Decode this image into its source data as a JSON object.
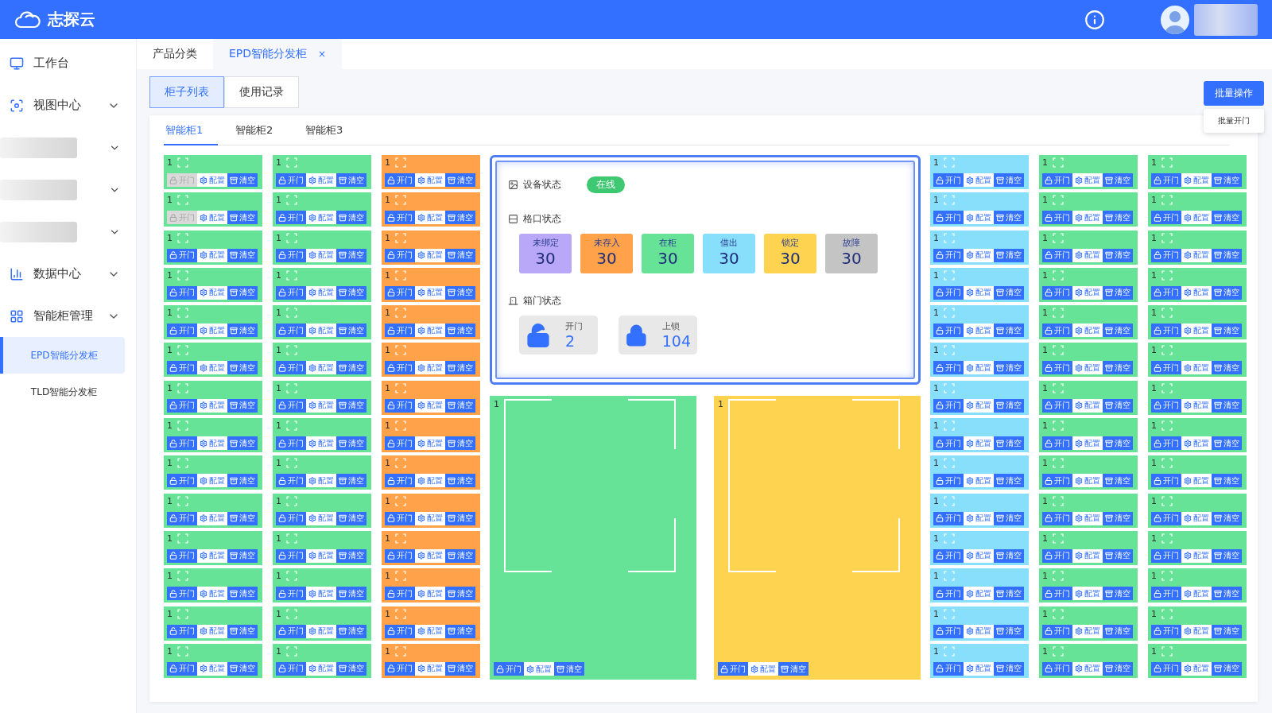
{
  "header": {
    "title": "志探云"
  },
  "sidebar": {
    "items": [
      {
        "kind": "link",
        "label": "工作台"
      },
      {
        "kind": "group",
        "label": "视图中心"
      },
      {
        "kind": "redacted"
      },
      {
        "kind": "redacted"
      },
      {
        "kind": "redacted"
      },
      {
        "kind": "group",
        "label": "数据中心"
      },
      {
        "kind": "group",
        "label": "智能柜管理",
        "children": [
          {
            "label": "EPD智能分发柜",
            "selected": true
          },
          {
            "label": "TLD智能分发柜",
            "selected": false
          }
        ]
      }
    ]
  },
  "page_tabs": [
    {
      "label": "产品分类",
      "selected": false
    },
    {
      "label": "EPD智能分发柜",
      "selected": true,
      "close": "×"
    }
  ],
  "view_tabs": [
    {
      "label": "柜子列表",
      "selected": true
    },
    {
      "label": "使用记录",
      "selected": false
    }
  ],
  "batch": {
    "button": "批量操作",
    "menu": [
      "批量开门"
    ]
  },
  "cabinet_tabs": [
    {
      "label": "智能柜1",
      "selected": true
    },
    {
      "label": "智能柜2",
      "selected": false
    },
    {
      "label": "智能柜3",
      "selected": false
    }
  ],
  "left_columns": [
    {
      "cells": [
        {
          "no": "1",
          "color": "#66e396",
          "open_disabled": true,
          "actions": [
            "开门",
            "配置",
            "清空"
          ]
        },
        {
          "no": "1",
          "color": "#66e396",
          "open_disabled": true,
          "actions": [
            "开门",
            "配置",
            "清空"
          ]
        },
        {
          "no": "1",
          "color": "#66e396",
          "open_disabled": false,
          "actions": [
            "开门",
            "配置",
            "清空"
          ]
        },
        {
          "no": "1",
          "color": "#66e396",
          "open_disabled": false,
          "actions": [
            "开门",
            "配置",
            "清空"
          ]
        },
        {
          "no": "1",
          "color": "#66e396",
          "open_disabled": false,
          "actions": [
            "开门",
            "配置",
            "清空"
          ]
        },
        {
          "no": "1",
          "color": "#66e396",
          "open_disabled": false,
          "actions": [
            "开门",
            "配置",
            "清空"
          ]
        },
        {
          "no": "1",
          "color": "#66e396",
          "open_disabled": false,
          "actions": [
            "开门",
            "配置",
            "清空"
          ]
        },
        {
          "no": "1",
          "color": "#66e396",
          "open_disabled": false,
          "actions": [
            "开门",
            "配置",
            "清空"
          ]
        },
        {
          "no": "1",
          "color": "#66e396",
          "open_disabled": false,
          "actions": [
            "开门",
            "配置",
            "清空"
          ]
        },
        {
          "no": "1",
          "color": "#66e396",
          "open_disabled": false,
          "actions": [
            "开门",
            "配置",
            "清空"
          ]
        },
        {
          "no": "1",
          "color": "#66e396",
          "open_disabled": false,
          "actions": [
            "开门",
            "配置",
            "清空"
          ]
        },
        {
          "no": "1",
          "color": "#66e396",
          "open_disabled": false,
          "actions": [
            "开门",
            "配置",
            "清空"
          ]
        },
        {
          "no": "1",
          "color": "#66e396",
          "open_disabled": false,
          "actions": [
            "开门",
            "配置",
            "清空"
          ]
        },
        {
          "no": "1",
          "color": "#66e396",
          "open_disabled": false,
          "actions": [
            "开门",
            "配置",
            "清空"
          ]
        }
      ]
    },
    {
      "cells": [
        {
          "no": "1",
          "color": "#66e396",
          "open_disabled": false,
          "actions": [
            "开门",
            "配置",
            "清空"
          ]
        },
        {
          "no": "1",
          "color": "#66e396",
          "open_disabled": false,
          "actions": [
            "开门",
            "配置",
            "清空"
          ]
        },
        {
          "no": "1",
          "color": "#66e396",
          "open_disabled": false,
          "actions": [
            "开门",
            "配置",
            "清空"
          ]
        },
        {
          "no": "1",
          "color": "#66e396",
          "open_disabled": false,
          "actions": [
            "开门",
            "配置",
            "清空"
          ]
        },
        {
          "no": "1",
          "color": "#66e396",
          "open_disabled": false,
          "actions": [
            "开门",
            "配置",
            "清空"
          ]
        },
        {
          "no": "1",
          "color": "#66e396",
          "open_disabled": false,
          "actions": [
            "开门",
            "配置",
            "清空"
          ]
        },
        {
          "no": "1",
          "color": "#66e396",
          "open_disabled": false,
          "actions": [
            "开门",
            "配置",
            "清空"
          ]
        },
        {
          "no": "1",
          "color": "#66e396",
          "open_disabled": false,
          "actions": [
            "开门",
            "配置",
            "清空"
          ]
        },
        {
          "no": "1",
          "color": "#66e396",
          "open_disabled": false,
          "actions": [
            "开门",
            "配置",
            "清空"
          ]
        },
        {
          "no": "1",
          "color": "#66e396",
          "open_disabled": false,
          "actions": [
            "开门",
            "配置",
            "清空"
          ]
        },
        {
          "no": "1",
          "color": "#66e396",
          "open_disabled": false,
          "actions": [
            "开门",
            "配置",
            "清空"
          ]
        },
        {
          "no": "1",
          "color": "#66e396",
          "open_disabled": false,
          "actions": [
            "开门",
            "配置",
            "清空"
          ]
        },
        {
          "no": "1",
          "color": "#66e396",
          "open_disabled": false,
          "actions": [
            "开门",
            "配置",
            "清空"
          ]
        },
        {
          "no": "1",
          "color": "#66e396",
          "open_disabled": false,
          "actions": [
            "开门",
            "配置",
            "清空"
          ]
        }
      ]
    },
    {
      "cells": [
        {
          "no": "1",
          "color": "#ffa24a",
          "open_disabled": false,
          "actions": [
            "开门",
            "配置",
            "清空"
          ]
        },
        {
          "no": "1",
          "color": "#ffa24a",
          "open_disabled": false,
          "actions": [
            "开门",
            "配置",
            "清空"
          ]
        },
        {
          "no": "1",
          "color": "#ffa24a",
          "open_disabled": false,
          "actions": [
            "开门",
            "配置",
            "清空"
          ]
        },
        {
          "no": "1",
          "color": "#ffa24a",
          "open_disabled": false,
          "actions": [
            "开门",
            "配置",
            "清空"
          ]
        },
        {
          "no": "1",
          "color": "#ffa24a",
          "open_disabled": false,
          "actions": [
            "开门",
            "配置",
            "清空"
          ]
        },
        {
          "no": "1",
          "color": "#ffa24a",
          "open_disabled": false,
          "actions": [
            "开门",
            "配置",
            "清空"
          ]
        },
        {
          "no": "1",
          "color": "#ffa24a",
          "open_disabled": false,
          "actions": [
            "开门",
            "配置",
            "清空"
          ]
        },
        {
          "no": "1",
          "color": "#ffa24a",
          "open_disabled": false,
          "actions": [
            "开门",
            "配置",
            "清空"
          ]
        },
        {
          "no": "1",
          "color": "#ffa24a",
          "open_disabled": false,
          "actions": [
            "开门",
            "配置",
            "清空"
          ]
        },
        {
          "no": "1",
          "color": "#ffa24a",
          "open_disabled": false,
          "actions": [
            "开门",
            "配置",
            "清空"
          ]
        },
        {
          "no": "1",
          "color": "#ffa24a",
          "open_disabled": false,
          "actions": [
            "开门",
            "配置",
            "清空"
          ]
        },
        {
          "no": "1",
          "color": "#ffa24a",
          "open_disabled": false,
          "actions": [
            "开门",
            "配置",
            "清空"
          ]
        },
        {
          "no": "1",
          "color": "#ffa24a",
          "open_disabled": false,
          "actions": [
            "开门",
            "配置",
            "清空"
          ]
        },
        {
          "no": "1",
          "color": "#ffa24a",
          "open_disabled": false,
          "actions": [
            "开门",
            "配置",
            "清空"
          ]
        }
      ]
    }
  ],
  "status_panel": {
    "device": {
      "label": "设备状态",
      "status": "在线",
      "online": true
    },
    "slots": {
      "label": "格口状态",
      "items": [
        {
          "label": "未绑定",
          "count": "30",
          "color": "#b9a8f8"
        },
        {
          "label": "未存入",
          "count": "30",
          "color": "#ffa24a"
        },
        {
          "label": "在柜",
          "count": "30",
          "color": "#66e396"
        },
        {
          "label": "借出",
          "count": "30",
          "color": "#87dffc"
        },
        {
          "label": "锁定",
          "count": "30",
          "color": "#fdd34f"
        },
        {
          "label": "故障",
          "count": "30",
          "color": "#c4c4c4"
        }
      ]
    },
    "doors": {
      "label": "箱门状态",
      "items": [
        {
          "kind": "open",
          "label": "开门",
          "count": "2"
        },
        {
          "kind": "locked",
          "label": "上锁",
          "count": "104"
        }
      ]
    }
  },
  "big_cells": [
    {
      "no": "1",
      "color": "#66e396",
      "open_disabled": false,
      "actions": [
        "开门",
        "配置",
        "清空"
      ]
    },
    {
      "no": "1",
      "color": "#fdd34f",
      "open_disabled": false,
      "actions": [
        "开门",
        "配置",
        "清空"
      ]
    }
  ],
  "right_columns": [
    {
      "cells": [
        {
          "no": "1",
          "color": "#87dffc",
          "open_disabled": false,
          "actions": [
            "开门",
            "配置",
            "清空"
          ]
        },
        {
          "no": "1",
          "color": "#87dffc",
          "open_disabled": false,
          "actions": [
            "开门",
            "配置",
            "清空"
          ]
        },
        {
          "no": "1",
          "color": "#87dffc",
          "open_disabled": false,
          "actions": [
            "开门",
            "配置",
            "清空"
          ]
        },
        {
          "no": "1",
          "color": "#87dffc",
          "open_disabled": false,
          "actions": [
            "开门",
            "配置",
            "清空"
          ]
        },
        {
          "no": "1",
          "color": "#87dffc",
          "open_disabled": false,
          "actions": [
            "开门",
            "配置",
            "清空"
          ]
        },
        {
          "no": "1",
          "color": "#87dffc",
          "open_disabled": false,
          "actions": [
            "开门",
            "配置",
            "清空"
          ]
        },
        {
          "no": "1",
          "color": "#87dffc",
          "open_disabled": false,
          "actions": [
            "开门",
            "配置",
            "清空"
          ]
        },
        {
          "no": "1",
          "color": "#87dffc",
          "open_disabled": false,
          "actions": [
            "开门",
            "配置",
            "清空"
          ]
        },
        {
          "no": "1",
          "color": "#87dffc",
          "open_disabled": false,
          "actions": [
            "开门",
            "配置",
            "清空"
          ]
        },
        {
          "no": "1",
          "color": "#87dffc",
          "open_disabled": false,
          "actions": [
            "开门",
            "配置",
            "清空"
          ]
        },
        {
          "no": "1",
          "color": "#87dffc",
          "open_disabled": false,
          "actions": [
            "开门",
            "配置",
            "清空"
          ]
        },
        {
          "no": "1",
          "color": "#87dffc",
          "open_disabled": false,
          "actions": [
            "开门",
            "配置",
            "清空"
          ]
        },
        {
          "no": "1",
          "color": "#87dffc",
          "open_disabled": false,
          "actions": [
            "开门",
            "配置",
            "清空"
          ]
        },
        {
          "no": "1",
          "color": "#87dffc",
          "open_disabled": false,
          "actions": [
            "开门",
            "配置",
            "清空"
          ]
        }
      ]
    },
    {
      "cells": [
        {
          "no": "1",
          "color": "#66e396",
          "open_disabled": false,
          "actions": [
            "开门",
            "配置",
            "清空"
          ]
        },
        {
          "no": "1",
          "color": "#66e396",
          "open_disabled": false,
          "actions": [
            "开门",
            "配置",
            "清空"
          ]
        },
        {
          "no": "1",
          "color": "#66e396",
          "open_disabled": false,
          "actions": [
            "开门",
            "配置",
            "清空"
          ]
        },
        {
          "no": "1",
          "color": "#66e396",
          "open_disabled": false,
          "actions": [
            "开门",
            "配置",
            "清空"
          ]
        },
        {
          "no": "1",
          "color": "#66e396",
          "open_disabled": false,
          "actions": [
            "开门",
            "配置",
            "清空"
          ]
        },
        {
          "no": "1",
          "color": "#66e396",
          "open_disabled": false,
          "actions": [
            "开门",
            "配置",
            "清空"
          ]
        },
        {
          "no": "1",
          "color": "#66e396",
          "open_disabled": false,
          "actions": [
            "开门",
            "配置",
            "清空"
          ]
        },
        {
          "no": "1",
          "color": "#66e396",
          "open_disabled": false,
          "actions": [
            "开门",
            "配置",
            "清空"
          ]
        },
        {
          "no": "1",
          "color": "#66e396",
          "open_disabled": false,
          "actions": [
            "开门",
            "配置",
            "清空"
          ]
        },
        {
          "no": "1",
          "color": "#66e396",
          "open_disabled": false,
          "actions": [
            "开门",
            "配置",
            "清空"
          ]
        },
        {
          "no": "1",
          "color": "#66e396",
          "open_disabled": false,
          "actions": [
            "开门",
            "配置",
            "清空"
          ]
        },
        {
          "no": "1",
          "color": "#66e396",
          "open_disabled": false,
          "actions": [
            "开门",
            "配置",
            "清空"
          ]
        },
        {
          "no": "1",
          "color": "#66e396",
          "open_disabled": false,
          "actions": [
            "开门",
            "配置",
            "清空"
          ]
        },
        {
          "no": "1",
          "color": "#66e396",
          "open_disabled": false,
          "actions": [
            "开门",
            "配置",
            "清空"
          ]
        }
      ]
    },
    {
      "cells": [
        {
          "no": "1",
          "color": "#66e396",
          "open_disabled": false,
          "actions": [
            "开门",
            "配置",
            "清空"
          ]
        },
        {
          "no": "1",
          "color": "#66e396",
          "open_disabled": false,
          "actions": [
            "开门",
            "配置",
            "清空"
          ]
        },
        {
          "no": "1",
          "color": "#66e396",
          "open_disabled": false,
          "actions": [
            "开门",
            "配置",
            "清空"
          ]
        },
        {
          "no": "1",
          "color": "#66e396",
          "open_disabled": false,
          "actions": [
            "开门",
            "配置",
            "清空"
          ]
        },
        {
          "no": "1",
          "color": "#66e396",
          "open_disabled": false,
          "actions": [
            "开门",
            "配置",
            "清空"
          ]
        },
        {
          "no": "1",
          "color": "#66e396",
          "open_disabled": false,
          "actions": [
            "开门",
            "配置",
            "清空"
          ]
        },
        {
          "no": "1",
          "color": "#66e396",
          "open_disabled": false,
          "actions": [
            "开门",
            "配置",
            "清空"
          ]
        },
        {
          "no": "1",
          "color": "#66e396",
          "open_disabled": false,
          "actions": [
            "开门",
            "配置",
            "清空"
          ]
        },
        {
          "no": "1",
          "color": "#66e396",
          "open_disabled": false,
          "actions": [
            "开门",
            "配置",
            "清空"
          ]
        },
        {
          "no": "1",
          "color": "#66e396",
          "open_disabled": false,
          "actions": [
            "开门",
            "配置",
            "清空"
          ]
        },
        {
          "no": "1",
          "color": "#66e396",
          "open_disabled": false,
          "actions": [
            "开门",
            "配置",
            "清空"
          ]
        },
        {
          "no": "1",
          "color": "#66e396",
          "open_disabled": false,
          "actions": [
            "开门",
            "配置",
            "清空"
          ]
        },
        {
          "no": "1",
          "color": "#66e396",
          "open_disabled": false,
          "actions": [
            "开门",
            "配置",
            "清空"
          ]
        },
        {
          "no": "1",
          "color": "#66e396",
          "open_disabled": false,
          "actions": [
            "开门",
            "配置",
            "清空"
          ]
        }
      ]
    }
  ]
}
